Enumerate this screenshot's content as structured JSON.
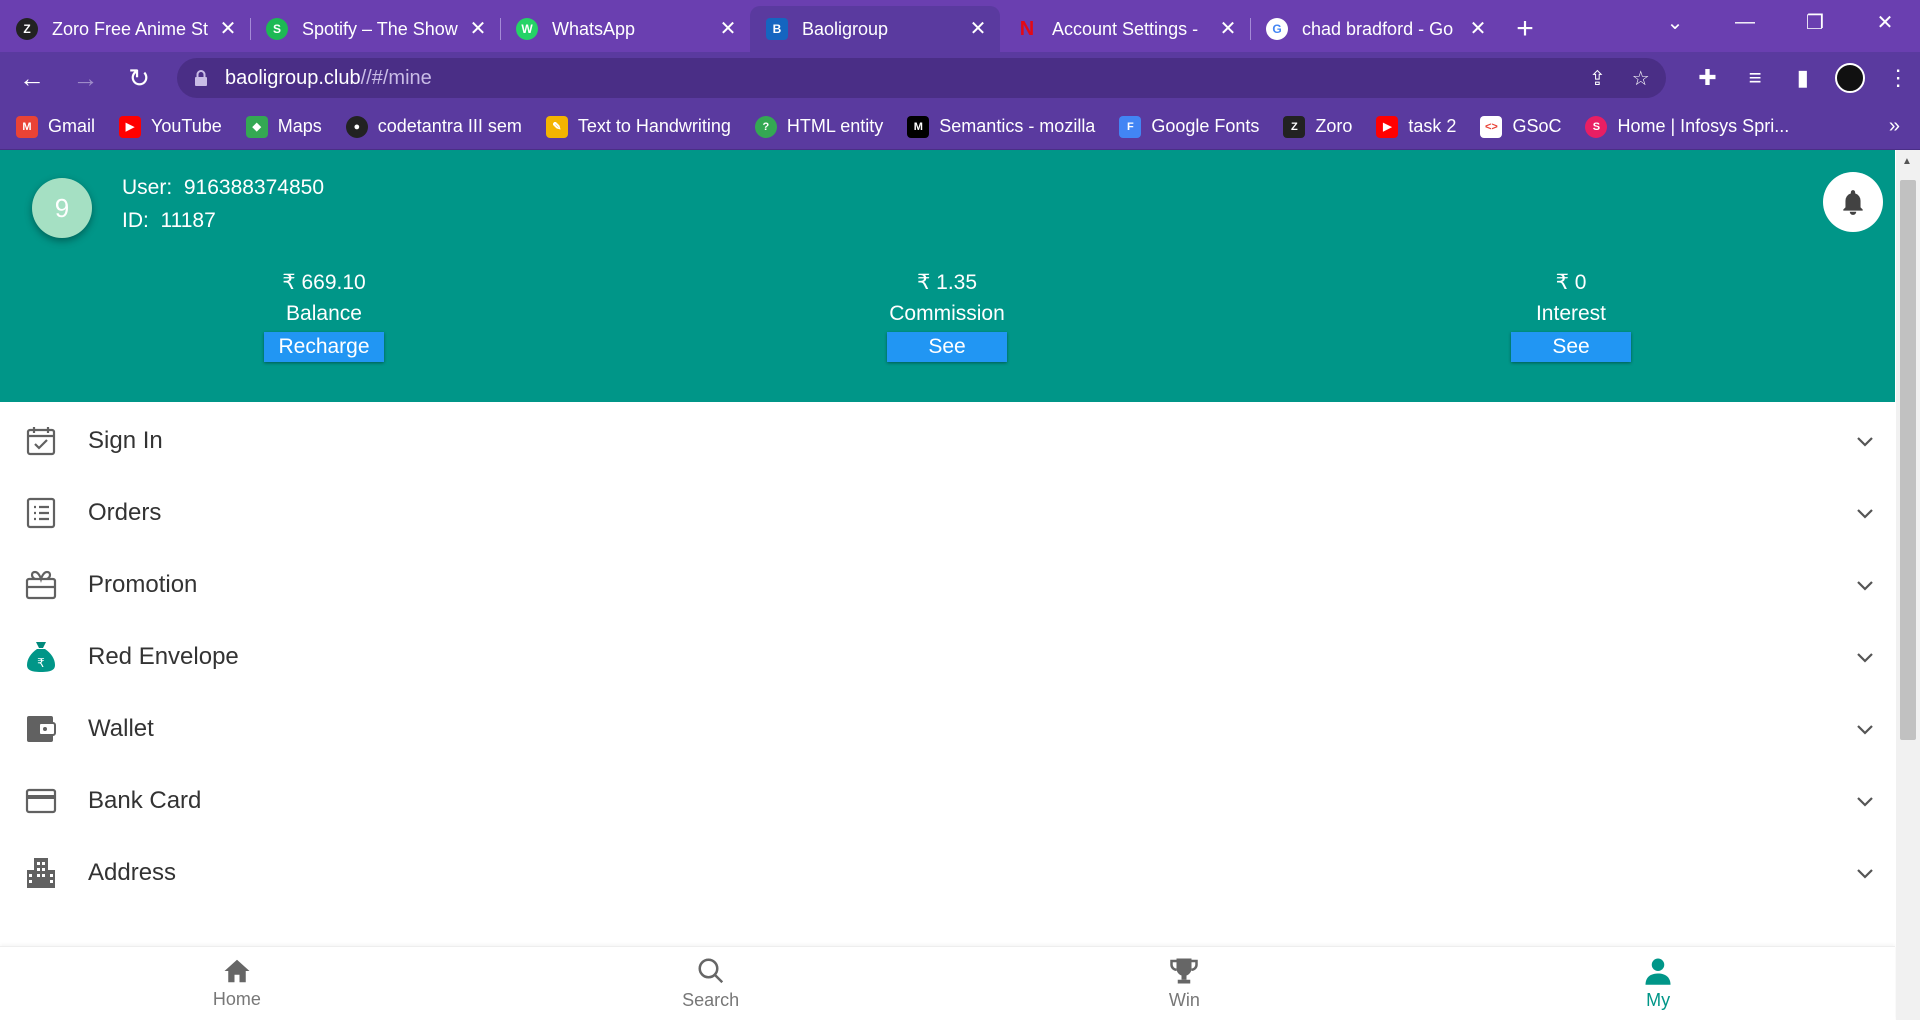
{
  "browser": {
    "tabs": [
      {
        "title": "Zoro Free Anime St",
        "favicon_color": "#222222",
        "favicon_glyph": "Z"
      },
      {
        "title": "Spotify – The Show",
        "favicon_color": "#1db954",
        "favicon_glyph": "S"
      },
      {
        "title": "WhatsApp",
        "favicon_color": "#25d366",
        "favicon_glyph": "W"
      },
      {
        "title": "Baoligroup",
        "favicon_color": "#1565c0",
        "favicon_glyph": "B"
      },
      {
        "title": "Account Settings - ",
        "favicon_color": "#e50914",
        "favicon_glyph": "N"
      },
      {
        "title": "chad bradford - Go",
        "favicon_color": "#ffffff",
        "favicon_glyph": "G"
      }
    ],
    "active_tab": 3,
    "url_host": "baoligroup.club",
    "url_path": "//#/mine",
    "bookmarks": [
      {
        "label": "Gmail",
        "color": "#ea4335",
        "glyph": "M"
      },
      {
        "label": "YouTube",
        "color": "#ff0000",
        "glyph": "▶"
      },
      {
        "label": "Maps",
        "color": "#34a853",
        "glyph": "◆"
      },
      {
        "label": "codetantra III sem",
        "color": "#222222",
        "glyph": "●"
      },
      {
        "label": "Text to Handwriting",
        "color": "#f4b400",
        "glyph": "✎"
      },
      {
        "label": "HTML entity",
        "color": "#34a853",
        "glyph": "?"
      },
      {
        "label": "Semantics - mozilla",
        "color": "#000000",
        "glyph": "M"
      },
      {
        "label": "Google Fonts",
        "color": "#4285f4",
        "glyph": "F"
      },
      {
        "label": "Zoro",
        "color": "#222222",
        "glyph": "Z"
      },
      {
        "label": "task 2",
        "color": "#ff0000",
        "glyph": "▶"
      },
      {
        "label": "GSoC",
        "color": "#ffffff",
        "glyph": "<>"
      },
      {
        "label": "Home | Infosys Spri...",
        "color": "#e91e63",
        "glyph": "S"
      }
    ]
  },
  "user": {
    "avatar_text": "9",
    "user_label": "User:",
    "user_value": "916388374850",
    "id_label": "ID:",
    "id_value": "11187"
  },
  "stats": [
    {
      "amount": "₹ 669.10",
      "label": "Balance",
      "button": "Recharge"
    },
    {
      "amount": "₹ 1.35",
      "label": "Commission",
      "button": "See"
    },
    {
      "amount": "₹ 0",
      "label": "Interest",
      "button": "See"
    }
  ],
  "menu": [
    {
      "label": "Sign In",
      "icon": "calendar-check-icon"
    },
    {
      "label": "Orders",
      "icon": "list-icon"
    },
    {
      "label": "Promotion",
      "icon": "gift-icon"
    },
    {
      "label": "Red Envelope",
      "icon": "money-bag-icon"
    },
    {
      "label": "Wallet",
      "icon": "wallet-icon"
    },
    {
      "label": "Bank Card",
      "icon": "credit-card-icon"
    },
    {
      "label": "Address",
      "icon": "building-icon"
    }
  ],
  "bottom_nav": [
    {
      "label": "Home",
      "icon": "home-icon"
    },
    {
      "label": "Search",
      "icon": "search-icon"
    },
    {
      "label": "Win",
      "icon": "trophy-icon"
    },
    {
      "label": "My",
      "icon": "person-icon"
    }
  ],
  "active_nav": 3,
  "colors": {
    "header": "#009688",
    "button": "#2196f3",
    "chrome": "#6a3fb0",
    "active_nav": "#009688"
  }
}
